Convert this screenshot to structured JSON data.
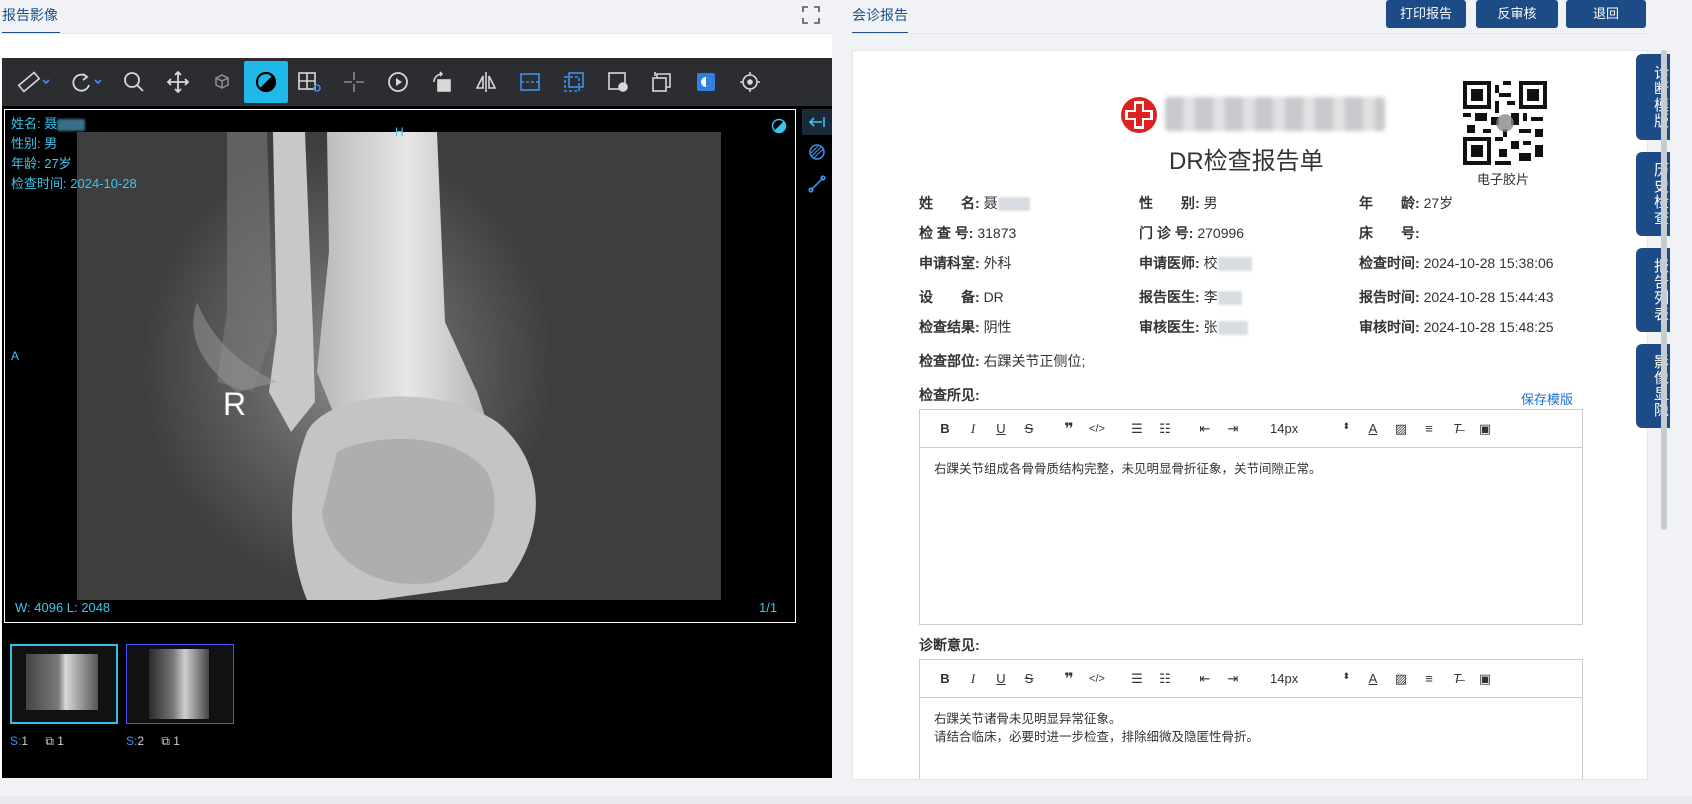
{
  "left_tab": "报告影像",
  "right_tab": "会诊报告",
  "fullscreen_icon": "fullscreen-icon",
  "buttons": {
    "print": "打印报告",
    "reverse": "反审核",
    "back": "退回"
  },
  "side_tabs": [
    "诊断模版",
    "历史检查",
    "报告列表",
    "影像显隐"
  ],
  "viewer": {
    "patient_name_label": "姓名:",
    "patient_name_value": "聂",
    "sex": "性别: 男",
    "age": "年龄: 27岁",
    "exam_time_label": "检查时间:",
    "exam_time_value": "2024-10-28",
    "orient_top": "H",
    "orient_left": "A",
    "marker": "R",
    "wl": "W: 4096 L: 2048",
    "frame": "1/1",
    "thumbnails": [
      {
        "series": "S:",
        "series_num": "1",
        "count": "1"
      },
      {
        "series": "S:",
        "series_num": "2",
        "count": "1"
      }
    ]
  },
  "report": {
    "title": "DR检查报告单",
    "qr_caption": "电子胶片",
    "fields": {
      "name_label": "姓　　名:",
      "name_value": "聂",
      "sex_label": "性　　别:",
      "sex_value": "男",
      "age_label": "年　　龄:",
      "age_value": "27岁",
      "exam_no_label": "检 查 号:",
      "exam_no_value": "31873",
      "clinic_no_label": "门 诊 号:",
      "clinic_no_value": "270996",
      "bed_label": "床　　号:",
      "bed_value": "",
      "dept_label": "申请科室:",
      "dept_value": "外科",
      "req_doc_label": "申请医师:",
      "req_doc_value": "校",
      "exam_time_label": "检查时间:",
      "exam_time_value": "2024-10-28 15:38:06",
      "device_label": "设　　备:",
      "device_value": "DR",
      "rep_doc_label": "报告医生:",
      "rep_doc_value": "李",
      "rep_time_label": "报告时间:",
      "rep_time_value": "2024-10-28 15:44:43",
      "result_label": "检查结果:",
      "result_value": "阴性",
      "audit_doc_label": "审核医生:",
      "audit_doc_value": "张",
      "audit_time_label": "审核时间:",
      "audit_time_value": "2024-10-28 15:48:25",
      "part_label": "检查部位:",
      "part_value": "右踝关节正侧位;"
    },
    "findings_label": "检查所见:",
    "save_template": "保存模版",
    "font_size": "14px",
    "findings_text": "右踝关节组成各骨骨质结构完整，未见明显骨折征象，关节间隙正常。",
    "diagnosis_label": "诊断意见:",
    "diagnosis_text_1": "右踝关节诸骨未见明显异常征象。",
    "diagnosis_text_2": "请结合临床，必要时进一步检查，排除细微及隐匿性骨折。"
  },
  "colors": {
    "primary": "#1c4b86",
    "accent": "#1fb8e8",
    "overlay_text": "#3ac6ee"
  }
}
